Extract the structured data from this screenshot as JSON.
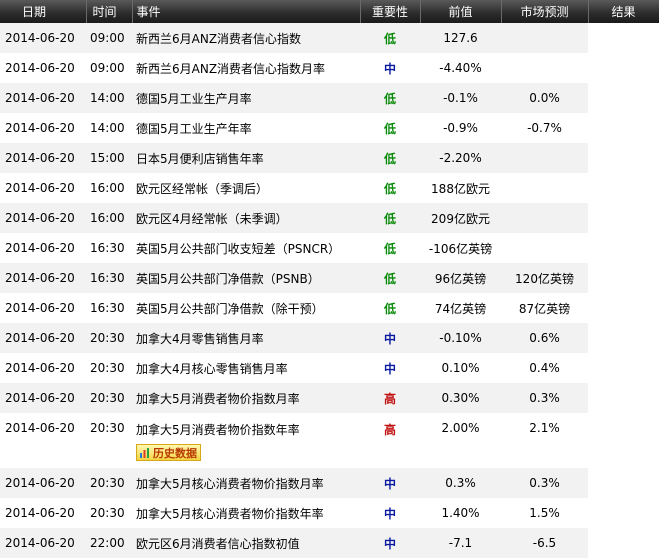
{
  "headers": [
    "日期",
    "时间",
    "事件",
    "重要性",
    "前值",
    "市场预测",
    "结果"
  ],
  "importance_colors": {
    "低": "#0a8a0a",
    "中": "#0a1aa0",
    "高": "#c01010"
  },
  "rows": [
    {
      "date": "2014-06-20",
      "time": "09:00",
      "event": "新西兰6月ANZ消费者信心指数",
      "importance": "低",
      "previous": "127.6",
      "forecast": "",
      "result": ""
    },
    {
      "date": "2014-06-20",
      "time": "09:00",
      "event": "新西兰6月ANZ消费者信心指数月率",
      "importance": "中",
      "previous": "-4.40%",
      "forecast": "",
      "result": ""
    },
    {
      "date": "2014-06-20",
      "time": "14:00",
      "event": "德国5月工业生产月率",
      "importance": "低",
      "previous": "-0.1%",
      "forecast": "0.0%",
      "result": ""
    },
    {
      "date": "2014-06-20",
      "time": "14:00",
      "event": "德国5月工业生产年率",
      "importance": "低",
      "previous": "-0.9%",
      "forecast": "-0.7%",
      "result": ""
    },
    {
      "date": "2014-06-20",
      "time": "15:00",
      "event": "日本5月便利店销售年率",
      "importance": "低",
      "previous": "-2.20%",
      "forecast": "",
      "result": ""
    },
    {
      "date": "2014-06-20",
      "time": "16:00",
      "event": "欧元区经常帐（季调后）",
      "importance": "低",
      "previous": "188亿欧元",
      "forecast": "",
      "result": ""
    },
    {
      "date": "2014-06-20",
      "time": "16:00",
      "event": "欧元区4月经常帐（未季调）",
      "importance": "低",
      "previous": "209亿欧元",
      "forecast": "",
      "result": ""
    },
    {
      "date": "2014-06-20",
      "time": "16:30",
      "event": "英国5月公共部门收支短差（PSNCR）",
      "importance": "低",
      "previous": "-106亿英镑",
      "forecast": "",
      "result": ""
    },
    {
      "date": "2014-06-20",
      "time": "16:30",
      "event": "英国5月公共部门净借款（PSNB）",
      "importance": "低",
      "previous": "96亿英镑",
      "forecast": "120亿英镑",
      "result": ""
    },
    {
      "date": "2014-06-20",
      "time": "16:30",
      "event": "英国5月公共部门净借款（除干预）",
      "importance": "低",
      "previous": "74亿英镑",
      "forecast": "87亿英镑",
      "result": ""
    },
    {
      "date": "2014-06-20",
      "time": "20:30",
      "event": "加拿大4月零售销售月率",
      "importance": "中",
      "previous": "-0.10%",
      "forecast": "0.6%",
      "result": ""
    },
    {
      "date": "2014-06-20",
      "time": "20:30",
      "event": "加拿大4月核心零售销售月率",
      "importance": "中",
      "previous": "0.10%",
      "forecast": "0.4%",
      "result": ""
    },
    {
      "date": "2014-06-20",
      "time": "20:30",
      "event": "加拿大5月消费者物价指数月率",
      "importance": "高",
      "previous": "0.30%",
      "forecast": "0.3%",
      "result": ""
    },
    {
      "date": "2014-06-20",
      "time": "20:30",
      "event": "加拿大5月消费者物价指数年率",
      "importance": "高",
      "previous": "2.00%",
      "forecast": "2.1%",
      "result": "",
      "history_label": "历史数据"
    },
    {
      "date": "2014-06-20",
      "time": "20:30",
      "event": "加拿大5月核心消费者物价指数月率",
      "importance": "中",
      "previous": "0.3%",
      "forecast": "0.3%",
      "result": ""
    },
    {
      "date": "2014-06-20",
      "time": "20:30",
      "event": "加拿大5月核心消费者物价指数年率",
      "importance": "中",
      "previous": "1.40%",
      "forecast": "1.5%",
      "result": ""
    },
    {
      "date": "2014-06-20",
      "time": "22:00",
      "event": "欧元区6月消费者信心指数初值",
      "importance": "中",
      "previous": "-7.1",
      "forecast": "-6.5",
      "result": ""
    }
  ]
}
